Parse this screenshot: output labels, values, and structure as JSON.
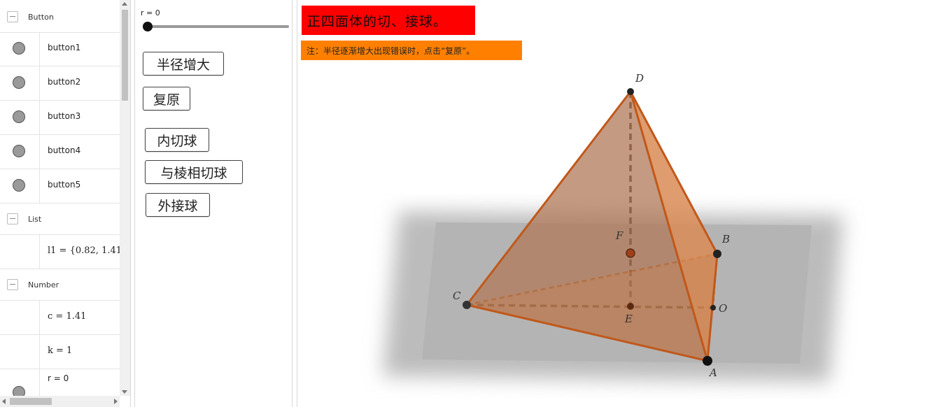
{
  "algebra": {
    "groups": {
      "button": "Button",
      "list": "List",
      "number": "Number"
    },
    "buttons": [
      "button1",
      "button2",
      "button3",
      "button4",
      "button5"
    ],
    "list_expr": "l1 = {0.82, 1.41,",
    "numbers": [
      "c = 1.41",
      "k = 1",
      "r = 0"
    ]
  },
  "graphics": {
    "slider_label": "r = 0",
    "buttons": {
      "increase_radius": "半径增大",
      "reset": "复原",
      "inscribed_sphere": "内切球",
      "edge_tangent_sphere": "与棱相切球",
      "circumscribed_sphere": "外接球"
    }
  },
  "view3d": {
    "title": "正四面体的切、接球。",
    "note": "注：半径逐渐增大出现错误时，点击“复原”。",
    "points": {
      "A": "A",
      "B": "B",
      "C": "C",
      "D": "D",
      "E": "E",
      "F": "F",
      "O": "O"
    }
  },
  "colors": {
    "title_bg": "#ff0000",
    "note_bg": "#ff8000",
    "tetra_face": "#c97a45",
    "tetra_edge": "#c85a1a",
    "plane": "#bdbdbd"
  }
}
